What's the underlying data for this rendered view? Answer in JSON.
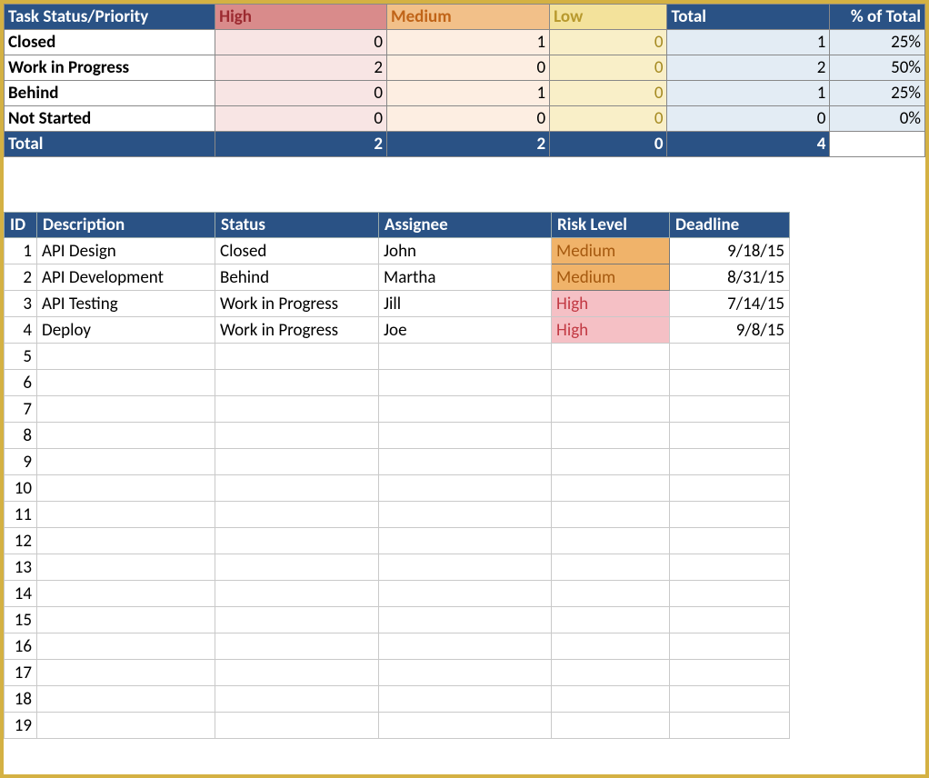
{
  "summary": {
    "header": {
      "title": "Task Status/Priority",
      "high": "High",
      "medium": "Medium",
      "low": "Low",
      "total": "Total",
      "pct": "% of Total"
    },
    "rows": [
      {
        "label": "Closed",
        "high": 0,
        "med": 1,
        "low": 0,
        "total": 1,
        "pct": "25%"
      },
      {
        "label": "Work in Progress",
        "high": 2,
        "med": 0,
        "low": 0,
        "total": 2,
        "pct": "50%"
      },
      {
        "label": "Behind",
        "high": 0,
        "med": 1,
        "low": 0,
        "total": 1,
        "pct": "25%"
      },
      {
        "label": "Not Started",
        "high": 0,
        "med": 0,
        "low": 0,
        "total": 0,
        "pct": "0%"
      }
    ],
    "totals": {
      "label": "Total",
      "high": 2,
      "med": 2,
      "low": 0,
      "total": 4,
      "pct": ""
    }
  },
  "tasks": {
    "header": {
      "id": "ID",
      "desc": "Description",
      "status": "Status",
      "assignee": "Assignee",
      "risk": "Risk Level",
      "deadline": "Deadline"
    },
    "rows": [
      {
        "id": 1,
        "desc": "API Design",
        "status": "Closed",
        "assignee": "John",
        "risk": "Medium",
        "deadline": "9/18/15"
      },
      {
        "id": 2,
        "desc": "API Development",
        "status": "Behind",
        "assignee": "Martha",
        "risk": "Medium",
        "deadline": "8/31/15"
      },
      {
        "id": 3,
        "desc": "API Testing",
        "status": "Work in Progress",
        "assignee": "Jill",
        "risk": "High",
        "deadline": "7/14/15"
      },
      {
        "id": 4,
        "desc": "Deploy",
        "status": "Work in Progress",
        "assignee": "Joe",
        "risk": "High",
        "deadline": "9/8/15"
      }
    ],
    "empty_ids": [
      5,
      6,
      7,
      8,
      9,
      10,
      11,
      12,
      13,
      14,
      15,
      16,
      17,
      18,
      19
    ]
  }
}
